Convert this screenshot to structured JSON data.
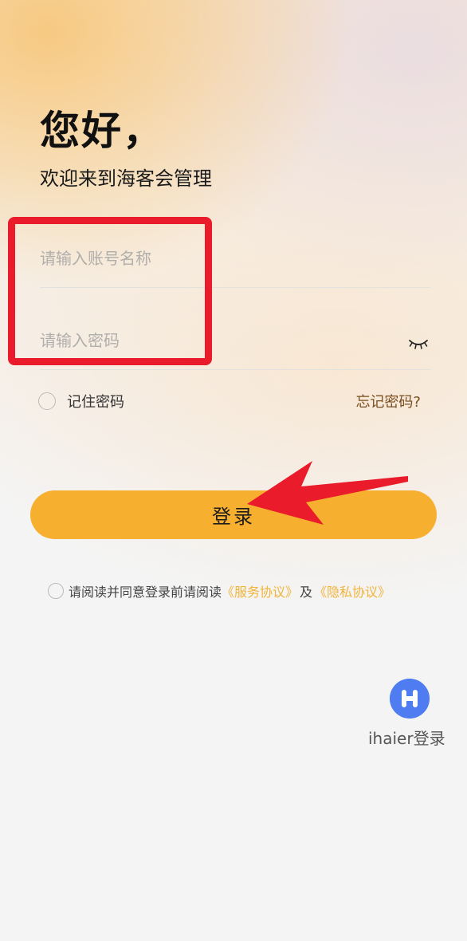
{
  "header": {
    "greeting": "您好，",
    "welcome": "欢迎来到海客会管理"
  },
  "form": {
    "account_placeholder": "请输入账号名称",
    "password_placeholder": "请输入密码",
    "password_toggle_icon": "eye-closed-icon",
    "remember_label": "记住密码",
    "forgot_label": "忘记密码?",
    "login_label": "登录"
  },
  "agreement": {
    "prefix": "请阅读并同意登录前请阅读",
    "service_link": "《服务协议》",
    "conjunction": "及",
    "privacy_link": "《隐私协议》"
  },
  "alt_login": {
    "icon": "ihaier-logo-icon",
    "label": "ihaier登录"
  },
  "colors": {
    "accent": "#f6af2f",
    "link": "#f1b43a",
    "annotation": "#ea1b2b",
    "ihaier": "#4f7df1"
  }
}
